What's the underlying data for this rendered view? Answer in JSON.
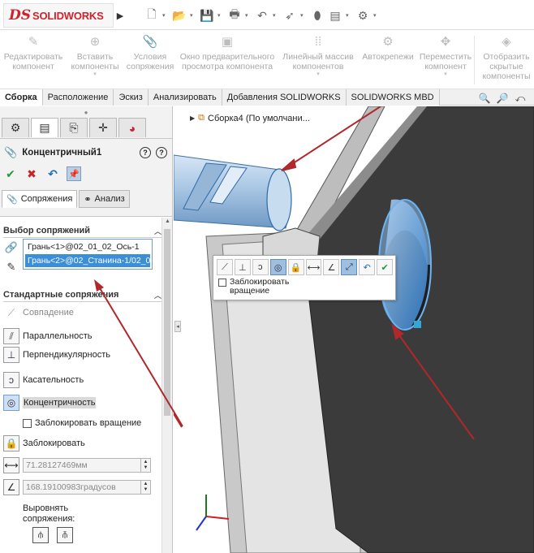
{
  "app": {
    "logo_prefix": "DS",
    "logo_text": "SOLIDWORKS",
    "logo_arrow": "▶"
  },
  "quick_access": [
    {
      "icon": "new-document-icon",
      "glyph": "🗋",
      "dropdown": "▾"
    },
    {
      "icon": "open-folder-icon",
      "glyph": "📂",
      "dropdown": "▾"
    },
    {
      "icon": "save-icon",
      "glyph": "💾",
      "dropdown": "▾"
    },
    {
      "icon": "print-icon",
      "glyph": "🖶",
      "dropdown": "▾"
    },
    {
      "icon": "undo-icon",
      "glyph": "↶",
      "dropdown": "▾"
    },
    {
      "icon": "select-pointer-icon",
      "glyph": "➶",
      "dropdown": "▾"
    },
    {
      "icon": "rebuild-icon",
      "glyph": "⬮",
      "dropdown": ""
    },
    {
      "icon": "file-properties-icon",
      "glyph": "▤",
      "dropdown": "▾"
    },
    {
      "icon": "options-gear-icon",
      "glyph": "⚙",
      "dropdown": "▾"
    }
  ],
  "commands": [
    {
      "name": "edit-component",
      "label1": "Редактировать",
      "label2": "компонент",
      "glyph": "✎",
      "arrow": ""
    },
    {
      "name": "insert-components",
      "label1": "Вставить",
      "label2": "компоненты",
      "glyph": "⊕",
      "arrow": "▾"
    },
    {
      "name": "mate-conditions",
      "label1": "Условия",
      "label2": "сопряжения",
      "glyph": "📎",
      "arrow": ""
    },
    {
      "name": "component-preview-window",
      "label1": "Окно предварительного",
      "label2": "просмотра компонента",
      "glyph": "▣",
      "arrow": ""
    },
    {
      "name": "linear-component-pattern",
      "label1": "Линейный массив",
      "label2": "компонентов",
      "glyph": "⁞⁞",
      "arrow": "▾"
    },
    {
      "name": "smart-fasteners",
      "label1": "Автокрепежи",
      "label2": "",
      "glyph": "⚙",
      "arrow": ""
    },
    {
      "name": "move-component",
      "label1": "Переместить",
      "label2": "компонент",
      "glyph": "✥",
      "arrow": "▾"
    },
    {
      "name": "show-hidden-components",
      "label1": "Отобразить",
      "label2": "скрытые",
      "label3": "компоненты",
      "glyph": "◈",
      "arrow": ""
    }
  ],
  "tabs": [
    "Сборка",
    "Расположение",
    "Эскиз",
    "Анализировать",
    "Добавления SOLIDWORKS",
    "SOLIDWORKS MBD"
  ],
  "panel": {
    "grip": "●",
    "title": "Концентричный1",
    "subtabs": [
      "Сопряжения",
      "Анализ"
    ],
    "section_selection": "Выбор сопряжений",
    "selections": [
      "Грань<1>@02_01_02_Ось-1",
      "Грань<2>@02_Станина-1/02_0"
    ],
    "section_standard": "Стандартные сопряжения",
    "mates": [
      {
        "label": "Совпадение",
        "glyph": "⟋",
        "state": "dim"
      },
      {
        "label": "Параллельность",
        "glyph": "⫽",
        "state": "normal"
      },
      {
        "label": "Перпендикулярность",
        "glyph": "⊥",
        "state": "normal"
      },
      {
        "label": "Касательность",
        "glyph": "ↄ",
        "state": "normal"
      },
      {
        "label": "Концентричность",
        "glyph": "◎",
        "state": "selected"
      }
    ],
    "lock_rotation": "Заблокировать вращение",
    "lock": "Заблокировать",
    "distance_value": "71.28127469мм",
    "angle_value": "168.19100983градусов",
    "align_label_1": "Выровнять",
    "align_label_2": "сопряжения:"
  },
  "viewport": {
    "tree_label": "Сборка4  (По умолчани...",
    "context_checkbox_line1": "Заблокировать",
    "context_checkbox_line2": "вращение",
    "annotation_color": "#b0282b"
  }
}
